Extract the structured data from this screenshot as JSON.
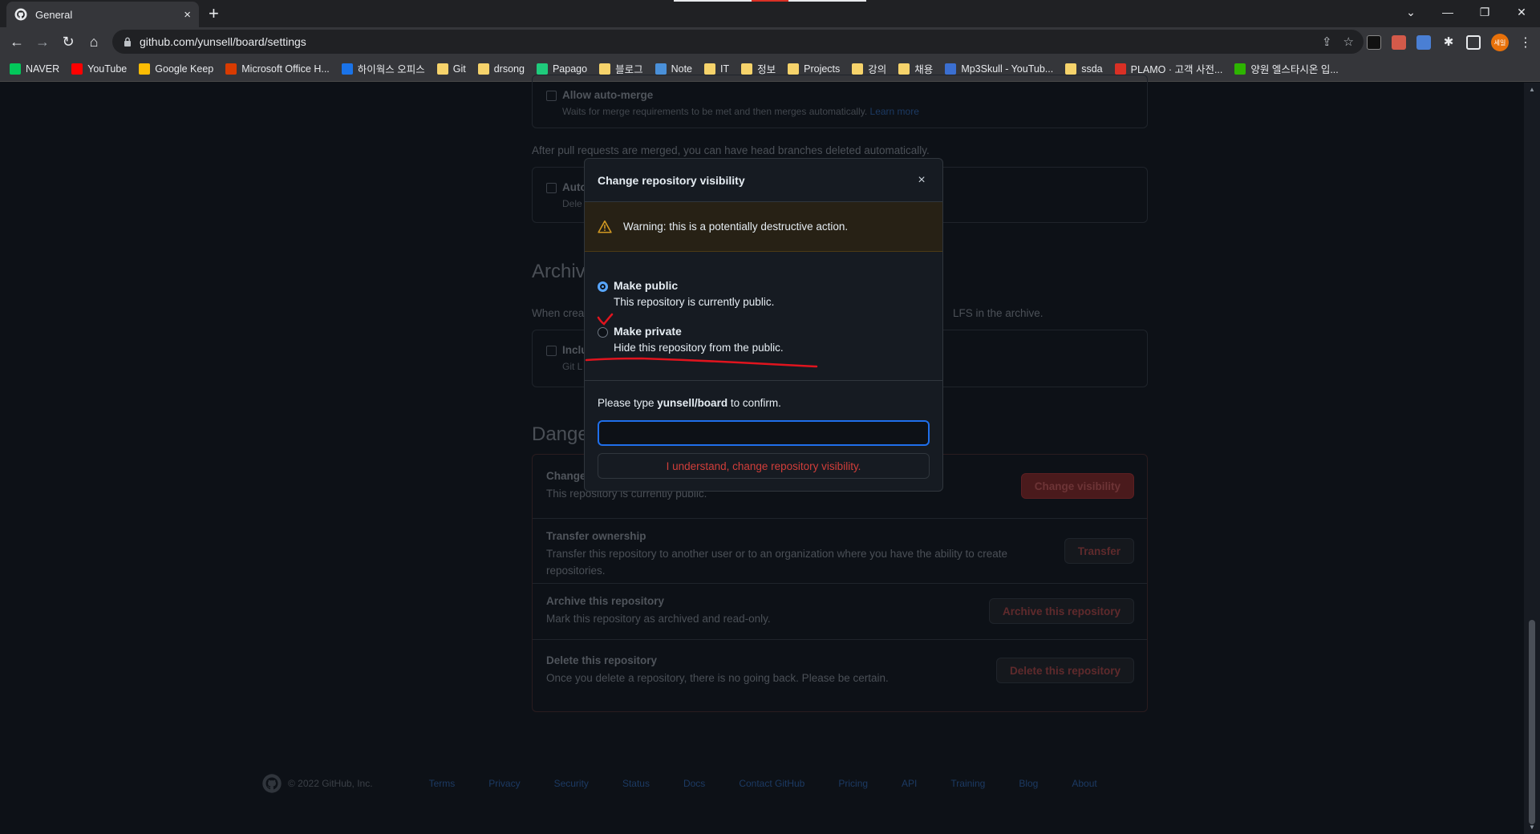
{
  "browser": {
    "tab_title": "General",
    "tab_close": "×",
    "new_tab": "+",
    "url": "github.com/yunsell/board/settings",
    "profile_initials": "세일"
  },
  "bookmarks": [
    {
      "label": "NAVER",
      "color": "#03c75a"
    },
    {
      "label": "YouTube",
      "color": "#ff0000"
    },
    {
      "label": "Google Keep",
      "color": "#fbbc04"
    },
    {
      "label": "Microsoft Office H...",
      "color": "#d83b01"
    },
    {
      "label": "하이웍스 오피스",
      "color": "#1a73e8"
    },
    {
      "label": "Git",
      "color": "#f6d36b"
    },
    {
      "label": "drsong",
      "color": "#f6d36b"
    },
    {
      "label": "Papago",
      "color": "#1fcb7c"
    },
    {
      "label": "블로그",
      "color": "#f6d36b"
    },
    {
      "label": "Note",
      "color": "#4a90d9"
    },
    {
      "label": "IT",
      "color": "#f6d36b"
    },
    {
      "label": "정보",
      "color": "#f6d36b"
    },
    {
      "label": "Projects",
      "color": "#f6d36b"
    },
    {
      "label": "강의",
      "color": "#f6d36b"
    },
    {
      "label": "채용",
      "color": "#f6d36b"
    },
    {
      "label": "Mp3Skull - YouTub...",
      "color": "#3b6fd1"
    },
    {
      "label": "ssda",
      "color": "#f6d36b"
    },
    {
      "label": "PLAMO · 고객 사전...",
      "color": "#d93025"
    },
    {
      "label": "양원 엘스타시온 입...",
      "color": "#2db400"
    }
  ],
  "settings_bg": {
    "allow_auto_merge": "Allow auto-merge",
    "allow_auto_merge_desc": "Waits for merge requirements to be met and then merges automatically.",
    "learn_more": "Learn more",
    "after_merge": "After pull requests are merged, you can have head branches deleted automatically.",
    "auto_delete_partial": "Auto",
    "auto_delete_desc_partial": "Dele",
    "archives_partial": "Archiv",
    "archives_desc_partial": "When crea",
    "archives_desc_tail": "LFS in the archive.",
    "include_partial": "Inclu",
    "include_desc_partial": "Git L",
    "danger_partial": "Dange",
    "rows": [
      {
        "title": "Change",
        "desc": "This repository is currently public.",
        "button": "Change visibility"
      },
      {
        "title": "Transfer ownership",
        "desc": "Transfer this repository to another user or to an organization where you have the ability to create repositories.",
        "button": "Transfer"
      },
      {
        "title": "Archive this repository",
        "desc": "Mark this repository as archived and read-only.",
        "button": "Archive this repository"
      },
      {
        "title": "Delete this repository",
        "desc": "Once you delete a repository, there is no going back. Please be certain.",
        "button": "Delete this repository"
      }
    ]
  },
  "footer": {
    "copyright": "© 2022 GitHub, Inc.",
    "links": [
      "Terms",
      "Privacy",
      "Security",
      "Status",
      "Docs",
      "Contact GitHub",
      "Pricing",
      "API",
      "Training",
      "Blog",
      "About"
    ]
  },
  "modal": {
    "title": "Change repository visibility",
    "close": "×",
    "warning": "Warning: this is a potentially destructive action.",
    "options": [
      {
        "label": "Make public",
        "desc": "This repository is currently public.",
        "checked": true
      },
      {
        "label": "Make private",
        "desc": "Hide this repository from the public.",
        "checked": false
      }
    ],
    "confirm_prefix": "Please type ",
    "confirm_repo": "yunsell/board",
    "confirm_suffix": " to confirm.",
    "input_value": "",
    "confirm_button": "I understand, change repository visibility."
  },
  "colors": {
    "accent": "#58a6ff",
    "danger": "#d13e3a",
    "warning_bg": "#272115",
    "annotation_red": "#e0141e"
  }
}
